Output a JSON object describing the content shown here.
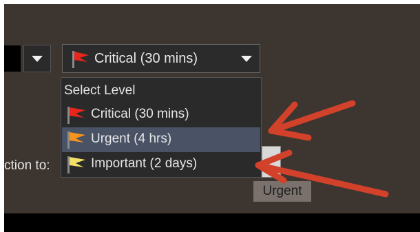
{
  "level_select": {
    "selected_label": "Critical (30 mins)",
    "icon": "red-flag-icon"
  },
  "menu": {
    "header": "Select Level",
    "items": [
      {
        "label": "Critical (30 mins)",
        "icon": "red-flag-icon",
        "color": "#e8261c"
      },
      {
        "label": "Urgent (4 hrs)",
        "icon": "orange-flag-icon",
        "color": "#f7941d",
        "selected": true
      },
      {
        "label": "Important (2 days)",
        "icon": "yellow-flag-icon",
        "color": "#f2e06a"
      }
    ]
  },
  "side_label": "ction to:",
  "urgent_tag": "Urgent",
  "annotation_arrow_color": "#d2412a"
}
